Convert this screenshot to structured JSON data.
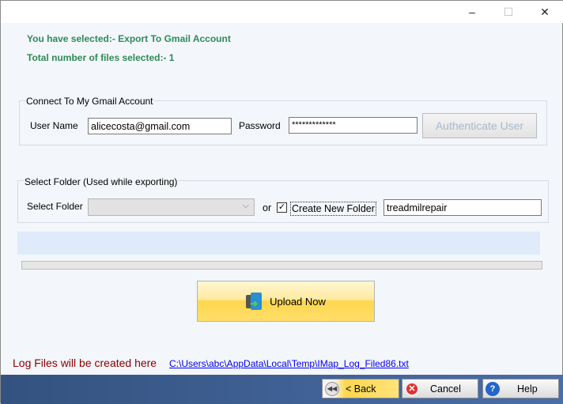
{
  "window": {
    "minimize": "–",
    "maximize": "☐",
    "close": "✕"
  },
  "info": {
    "selected": "You have selected:- Export To Gmail Account",
    "count": "Total number of files selected:- 1"
  },
  "gmail": {
    "legend": "Connect To My Gmail Account",
    "username_label": "User Name",
    "username": "alicecosta@gmail.com",
    "password_label": "Password",
    "password": "*************",
    "authenticate": "Authenticate User"
  },
  "folder": {
    "legend": "Select Folder (Used while exporting)",
    "select_label": "Select Folder",
    "selected": "",
    "or": "or",
    "create_checked": true,
    "create_label": "Create New Folder",
    "new_folder": "treadmilrepair"
  },
  "progress": 0,
  "upload": "Upload Now",
  "log": {
    "label": "Log Files will be created here",
    "path": "C:\\Users\\abc\\AppData\\Local\\Temp\\IMap_Log_Filed86.txt"
  },
  "footer": {
    "back": "< Back",
    "cancel": "Cancel",
    "help": "Help"
  },
  "colors": {
    "info": "#2e8b57",
    "log_label": "#8b0000",
    "link": "#0000ee",
    "bar": "#3a5a8a"
  }
}
